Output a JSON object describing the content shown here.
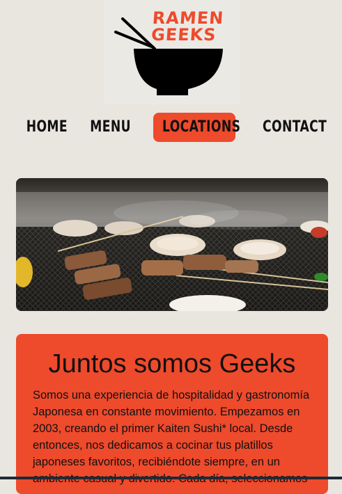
{
  "logo": {
    "line1": "RAMEN",
    "line2": "GEEKS",
    "icon": "ramen-bowl-chopsticks-icon",
    "accent": "#ee4a2c"
  },
  "nav": {
    "items": [
      {
        "label": "HOME"
      },
      {
        "label": "MENU"
      },
      {
        "label": "LOCATIONS",
        "active": true
      },
      {
        "label": "CONTACT"
      }
    ]
  },
  "hero": {
    "image": "grilled-scallops-and-skewers-photo"
  },
  "intro": {
    "title": "Juntos somos Geeks",
    "body": "Somos una experiencia de hospitalidad y gastronomía Japonesa en constante movimiento. Empezamos en 2003, creando el primer Kaiten Sushi* local. Desde entonces, nos dedicamos a cocinar tus platillos japoneses favoritos, recibiéndote siempre, en un ambiente casual y divertido. Cada día, seleccionamos"
  },
  "colors": {
    "background": "#e9e6e0",
    "accent": "#ee4a2c",
    "text": "#111111"
  }
}
